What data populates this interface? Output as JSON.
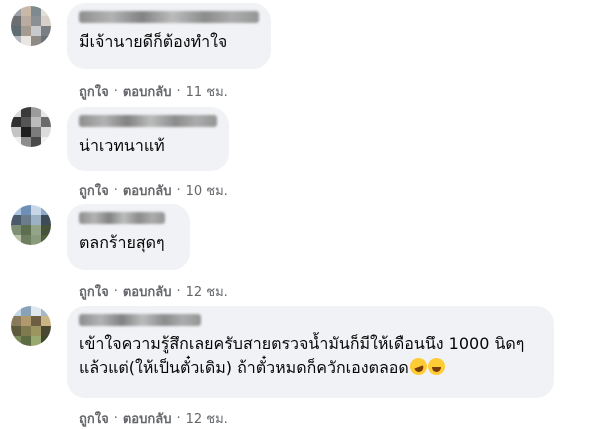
{
  "comments": [
    {
      "text": "มีเจ้านายดีก็ต้องทำใจ",
      "like_label": "ถูกใจ",
      "reply_label": "ตอบกลับ",
      "time": "11 ชม.",
      "avatar_colors": [
        "#9aa0a6",
        "#c9b8a8",
        "#7f8a8f",
        "#e2ddd6",
        "#6d6e72",
        "#b9aba0",
        "#8c8f94",
        "#d6d0c8",
        "#5f6b73",
        "#a59a90",
        "#c7c9cc",
        "#7a7f85",
        "#b5b9bd",
        "#e9e6e1",
        "#8e8a86",
        "#6a7278"
      ]
    },
    {
      "text": "น่าเวทนาแท้",
      "like_label": "ถูกใจ",
      "reply_label": "ตอบกลับ",
      "time": "10 ชม.",
      "avatar_colors": [
        "#d8d8d8",
        "#3a3a3a",
        "#9c9c9c",
        "#e6e6e6",
        "#2f2f2f",
        "#555555",
        "#bdbdbd",
        "#6b6b6b",
        "#c4c4c4",
        "#1f1f1f",
        "#7c7c7c",
        "#dcdcdc",
        "#efefef",
        "#8d8d8d",
        "#4a4a4a",
        "#f2f2f2"
      ]
    },
    {
      "text": "ตลกร้ายสุดๆ",
      "like_label": "ถูกใจ",
      "reply_label": "ตอบกลับ",
      "time": "12 ชม.",
      "avatar_colors": [
        "#a9c3df",
        "#6f8fb5",
        "#c8d7e8",
        "#8fa8c6",
        "#4a5a6a",
        "#6b7c8c",
        "#9db1c4",
        "#3e4c5a",
        "#7d8f74",
        "#5c6e4f",
        "#93a488",
        "#465239",
        "#b7c2a9",
        "#6e7f61",
        "#8a9a7c",
        "#52603f"
      ]
    },
    {
      "text": "เข้าใจความรู้สึกเลยครับสายตรวจน้ำมันก็มีให้เดือนนึง 1000 นิดๆแล้วแต่(ให้เป็นตั๋วเดิม) ถ้าตั๋วหมดก็ควักเองตลอด",
      "like_label": "ถูกใจ",
      "reply_label": "ตอบกลับ",
      "time": "12 ชม.",
      "avatar_colors": [
        "#c3d6e6",
        "#8aa2b8",
        "#dfe8ef",
        "#a5b8c9",
        "#8a7a5c",
        "#b09a6d",
        "#6e5f44",
        "#c9b483",
        "#5d5a3c",
        "#7f7a50",
        "#9c955f",
        "#4a4832",
        "#7a8a5a",
        "#5e6c43",
        "#9aa872",
        "#3f4a2c"
      ]
    }
  ]
}
